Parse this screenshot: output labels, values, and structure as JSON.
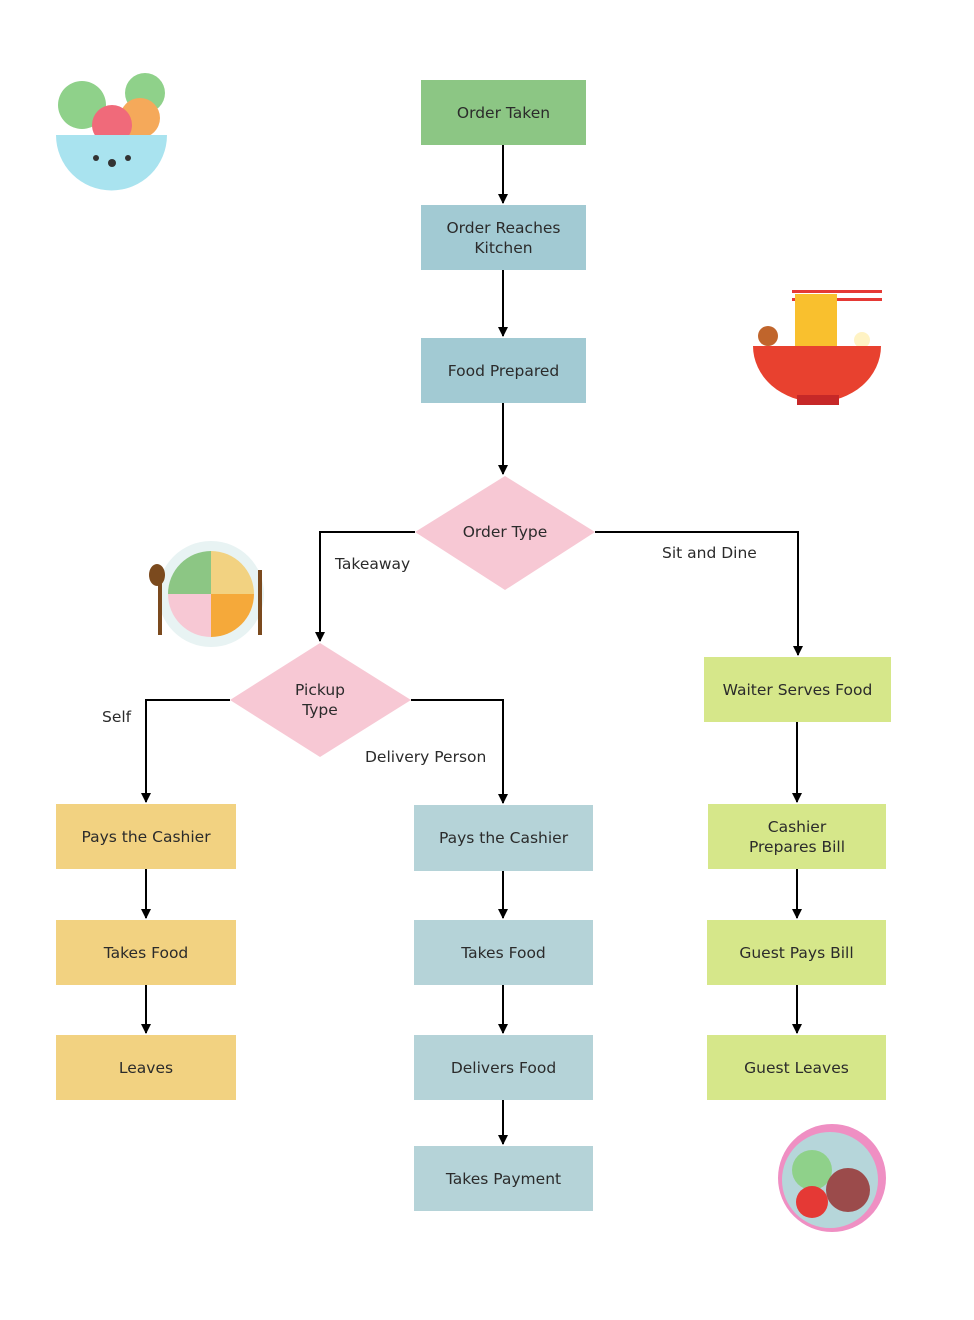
{
  "colors": {
    "start": "#8cc684",
    "kitchen": "#a2cad3",
    "decision": "#f7c8d4",
    "self_pickup": "#f2d281",
    "delivery": "#b5d3d8",
    "dine_in": "#d6e78a",
    "edge": "#000000"
  },
  "nodes": {
    "order_taken": "Order Taken",
    "order_reaches_kitchen": "Order Reaches Kitchen",
    "food_prepared": "Food Prepared",
    "order_type": "Order Type",
    "pickup_type": "Pickup Type",
    "waiter_serves_food": "Waiter Serves Food",
    "cashier_prepares_bill": "Cashier Prepares Bill",
    "guest_pays_bill": "Guest Pays Bill",
    "guest_leaves": "Guest Leaves",
    "self_pays_cashier": "Pays the Cashier",
    "self_takes_food": "Takes Food",
    "self_leaves": "Leaves",
    "delivery_pays_cashier": "Pays the Cashier",
    "delivery_takes_food": "Takes Food",
    "delivery_delivers_food": "Delivers Food",
    "delivery_takes_payment": "Takes Payment"
  },
  "edge_labels": {
    "takeaway": "Takeaway",
    "sit_and_dine": "Sit and Dine",
    "self": "Self",
    "delivery_person": "Delivery Person"
  },
  "illustrations": [
    "salad-bowl-icon",
    "ramen-bowl-icon",
    "food-plate-icon",
    "poke-bowl-icon"
  ]
}
